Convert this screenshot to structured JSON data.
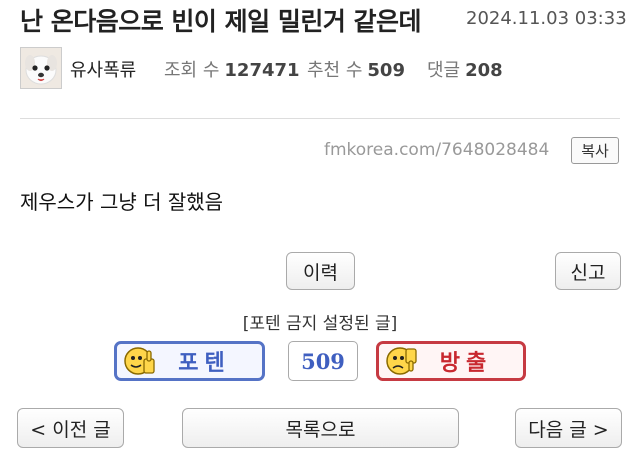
{
  "post": {
    "title": "난 온다음으로 빈이 제일 밀린거 같은데",
    "datetime": "2024.11.03 03:33",
    "author": "유사폭류",
    "views_label": "조회 수",
    "views": "127471",
    "recommend_label": "추천 수",
    "recommend": "509",
    "comments_label": "댓글",
    "comments": "208",
    "url": "fmkorea.com/7648028484",
    "copy_label": "복사",
    "body": "제우스가 그냥 더 잘했음"
  },
  "actions": {
    "history_label": "이력",
    "report_label": "신고",
    "notice": "[포텐 금지 설정된 글]",
    "upvote_label": "포텐",
    "vote_count": "509",
    "downvote_label": "방출"
  },
  "nav": {
    "prev_label": "< 이전 글",
    "list_label": "목록으로",
    "next_label": "다음 글 >"
  },
  "colors": {
    "upvote": "#5573c6",
    "downvote": "#c63a42",
    "count": "#3f5fc0"
  },
  "icons": {
    "avatar": "puppy-avatar",
    "upvote": "thumbs-up-face-icon",
    "downvote": "thumbs-down-face-icon"
  }
}
